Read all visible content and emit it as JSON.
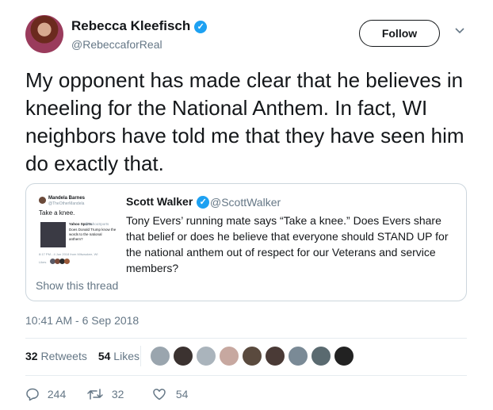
{
  "author": {
    "name": "Rebecca Kleefisch",
    "handle": "@RebeccaforReal",
    "verified_icon": "verified-badge-icon",
    "follow_label": "Follow"
  },
  "tweet": {
    "text": "My opponent has made clear that he believes in kneeling for the National Anthem. In fact, WI neighbors have told me that they have seen him do exactly that.",
    "timestamp": "10:41 AM - 6 Sep 2018"
  },
  "quoted": {
    "name": "Scott Walker",
    "handle": "@ScottWalker",
    "text": "Tony Evers’ running mate says “Take a knee.” Does Evers share that belief or does he believe that everyone should STAND UP for the national anthem out of respect for our Veterans and service members?",
    "show_thread": "Show this thread",
    "thumbnail": {
      "name": "Mandela Barnes",
      "handle": "@TheOtherMandela",
      "text": "Take a knee.",
      "embedded_name": "Yahoo Sports",
      "embedded_handle": "@YahooSports",
      "embedded_text": "Does Donald Trump know the words to the national anthem?",
      "meta": "8:17 PM - 4 Jun 2018 from Milwaukee, WI",
      "likes_label": "Likes"
    }
  },
  "stats": {
    "retweets_count": "32",
    "retweets_label": "Retweets",
    "likes_count": "54",
    "likes_label": "Likes"
  },
  "actions": {
    "reply_count": "244",
    "retweet_count": "32",
    "like_count": "54"
  },
  "colors": {
    "accent": "#1da1f2",
    "muted": "#657786",
    "border": "#ccd6dd"
  }
}
